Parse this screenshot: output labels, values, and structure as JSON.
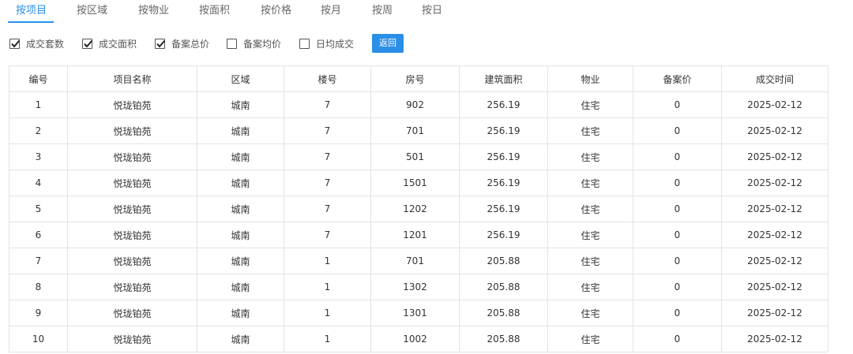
{
  "tabs": [
    {
      "label": "按项目",
      "active": true
    },
    {
      "label": "按区域",
      "active": false
    },
    {
      "label": "按物业",
      "active": false
    },
    {
      "label": "按面积",
      "active": false
    },
    {
      "label": "按价格",
      "active": false
    },
    {
      "label": "按月",
      "active": false
    },
    {
      "label": "按周",
      "active": false
    },
    {
      "label": "按日",
      "active": false
    }
  ],
  "filters": [
    {
      "label": "成交套数",
      "checked": true
    },
    {
      "label": "成交面积",
      "checked": true
    },
    {
      "label": "备案总价",
      "checked": true
    },
    {
      "label": "备案均价",
      "checked": false
    },
    {
      "label": "日均成交",
      "checked": false
    }
  ],
  "back_button_label": "返回",
  "accent_color": "#2b8fe8",
  "table": {
    "headers": [
      "编号",
      "项目名称",
      "区域",
      "楼号",
      "房号",
      "建筑面积",
      "物业",
      "备案价",
      "成交时间"
    ],
    "rows": [
      [
        "1",
        "悦珑铂苑",
        "城南",
        "7",
        "902",
        "256.19",
        "住宅",
        "0",
        "2025-02-12"
      ],
      [
        "2",
        "悦珑铂苑",
        "城南",
        "7",
        "701",
        "256.19",
        "住宅",
        "0",
        "2025-02-12"
      ],
      [
        "3",
        "悦珑铂苑",
        "城南",
        "7",
        "501",
        "256.19",
        "住宅",
        "0",
        "2025-02-12"
      ],
      [
        "4",
        "悦珑铂苑",
        "城南",
        "7",
        "1501",
        "256.19",
        "住宅",
        "0",
        "2025-02-12"
      ],
      [
        "5",
        "悦珑铂苑",
        "城南",
        "7",
        "1202",
        "256.19",
        "住宅",
        "0",
        "2025-02-12"
      ],
      [
        "6",
        "悦珑铂苑",
        "城南",
        "7",
        "1201",
        "256.19",
        "住宅",
        "0",
        "2025-02-12"
      ],
      [
        "7",
        "悦珑铂苑",
        "城南",
        "1",
        "701",
        "205.88",
        "住宅",
        "0",
        "2025-02-12"
      ],
      [
        "8",
        "悦珑铂苑",
        "城南",
        "1",
        "1302",
        "205.88",
        "住宅",
        "0",
        "2025-02-12"
      ],
      [
        "9",
        "悦珑铂苑",
        "城南",
        "1",
        "1301",
        "205.88",
        "住宅",
        "0",
        "2025-02-12"
      ],
      [
        "10",
        "悦珑铂苑",
        "城南",
        "1",
        "1002",
        "205.88",
        "住宅",
        "0",
        "2025-02-12"
      ]
    ]
  }
}
